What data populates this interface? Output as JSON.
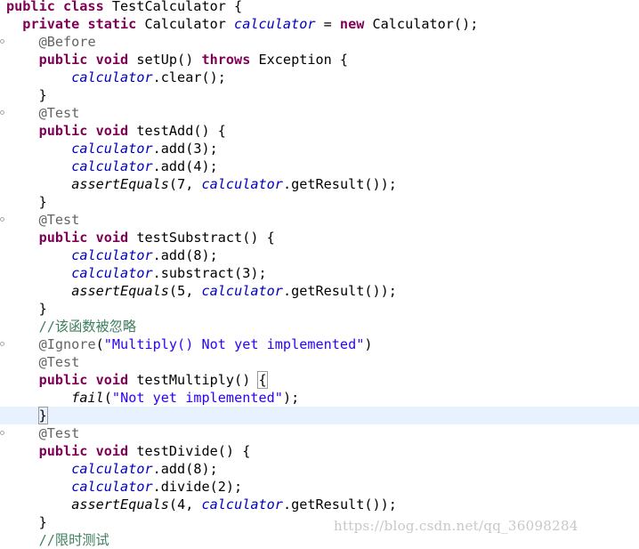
{
  "editor": {
    "lines": [
      {
        "indent": 0,
        "tokens": [
          {
            "t": "kw",
            "v": "public class "
          },
          {
            "t": "plain",
            "v": "TestCalculator {"
          }
        ]
      },
      {
        "indent": 2,
        "tokens": [
          {
            "t": "kw",
            "v": "private static "
          },
          {
            "t": "plain",
            "v": "Calculator "
          },
          {
            "t": "fld",
            "v": "calculator"
          },
          {
            "t": "plain",
            "v": " = "
          },
          {
            "t": "kw",
            "v": "new "
          },
          {
            "t": "plain",
            "v": "Calculator();"
          }
        ]
      },
      {
        "indent": 4,
        "marker": true,
        "tokens": [
          {
            "t": "ann",
            "v": "@Before"
          }
        ]
      },
      {
        "indent": 4,
        "tokens": [
          {
            "t": "kw",
            "v": "public void "
          },
          {
            "t": "plain",
            "v": "setUp() "
          },
          {
            "t": "kw",
            "v": "throws "
          },
          {
            "t": "plain",
            "v": "Exception {"
          }
        ]
      },
      {
        "indent": 8,
        "tokens": [
          {
            "t": "fld",
            "v": "calculator"
          },
          {
            "t": "plain",
            "v": ".clear();"
          }
        ]
      },
      {
        "indent": 4,
        "tokens": [
          {
            "t": "plain",
            "v": "}"
          }
        ]
      },
      {
        "indent": 4,
        "marker": true,
        "tokens": [
          {
            "t": "ann",
            "v": "@Test"
          }
        ]
      },
      {
        "indent": 4,
        "tokens": [
          {
            "t": "kw",
            "v": "public void "
          },
          {
            "t": "plain",
            "v": "testAdd() {"
          }
        ]
      },
      {
        "indent": 8,
        "tokens": [
          {
            "t": "fld",
            "v": "calculator"
          },
          {
            "t": "plain",
            "v": ".add(3);"
          }
        ]
      },
      {
        "indent": 8,
        "tokens": [
          {
            "t": "fld",
            "v": "calculator"
          },
          {
            "t": "plain",
            "v": ".add(4);"
          }
        ]
      },
      {
        "indent": 8,
        "tokens": [
          {
            "t": "stm",
            "v": "assertEquals"
          },
          {
            "t": "plain",
            "v": "(7, "
          },
          {
            "t": "fld",
            "v": "calculator"
          },
          {
            "t": "plain",
            "v": ".getResult());"
          }
        ]
      },
      {
        "indent": 4,
        "tokens": [
          {
            "t": "plain",
            "v": "}"
          }
        ]
      },
      {
        "indent": 4,
        "marker": true,
        "tokens": [
          {
            "t": "ann",
            "v": "@Test"
          }
        ]
      },
      {
        "indent": 4,
        "tokens": [
          {
            "t": "kw",
            "v": "public void "
          },
          {
            "t": "plain",
            "v": "testSubstract() {"
          }
        ]
      },
      {
        "indent": 8,
        "tokens": [
          {
            "t": "fld",
            "v": "calculator"
          },
          {
            "t": "plain",
            "v": ".add(8);"
          }
        ]
      },
      {
        "indent": 8,
        "tokens": [
          {
            "t": "fld",
            "v": "calculator"
          },
          {
            "t": "plain",
            "v": ".substract(3);"
          }
        ]
      },
      {
        "indent": 8,
        "tokens": [
          {
            "t": "stm",
            "v": "assertEquals"
          },
          {
            "t": "plain",
            "v": "(5, "
          },
          {
            "t": "fld",
            "v": "calculator"
          },
          {
            "t": "plain",
            "v": ".getResult());"
          }
        ]
      },
      {
        "indent": 4,
        "tokens": [
          {
            "t": "plain",
            "v": "}"
          }
        ]
      },
      {
        "indent": 4,
        "tokens": [
          {
            "t": "cmt",
            "v": "//该函数被忽略"
          }
        ]
      },
      {
        "indent": 4,
        "marker": true,
        "tokens": [
          {
            "t": "ann",
            "v": "@Ignore"
          },
          {
            "t": "plain",
            "v": "("
          },
          {
            "t": "str",
            "v": "\"Multiply() Not yet implemented\""
          },
          {
            "t": "plain",
            "v": ")"
          }
        ]
      },
      {
        "indent": 4,
        "tokens": [
          {
            "t": "ann",
            "v": "@Test"
          }
        ]
      },
      {
        "indent": 4,
        "tokens": [
          {
            "t": "kw",
            "v": "public void "
          },
          {
            "t": "plain",
            "v": "testMultiply() "
          },
          {
            "t": "box",
            "v": "{"
          }
        ]
      },
      {
        "indent": 8,
        "tokens": [
          {
            "t": "stm",
            "v": "fail"
          },
          {
            "t": "plain",
            "v": "("
          },
          {
            "t": "str",
            "v": "\"Not yet implemented\""
          },
          {
            "t": "plain",
            "v": ");"
          }
        ]
      },
      {
        "indent": 4,
        "current": true,
        "tokens": [
          {
            "t": "box",
            "v": "}"
          }
        ]
      },
      {
        "indent": 4,
        "marker": true,
        "tokens": [
          {
            "t": "ann",
            "v": "@Test"
          }
        ]
      },
      {
        "indent": 4,
        "tokens": [
          {
            "t": "kw",
            "v": "public void "
          },
          {
            "t": "plain",
            "v": "testDivide() {"
          }
        ]
      },
      {
        "indent": 8,
        "tokens": [
          {
            "t": "fld",
            "v": "calculator"
          },
          {
            "t": "plain",
            "v": ".add(8);"
          }
        ]
      },
      {
        "indent": 8,
        "tokens": [
          {
            "t": "fld",
            "v": "calculator"
          },
          {
            "t": "plain",
            "v": ".divide(2);"
          }
        ]
      },
      {
        "indent": 8,
        "tokens": [
          {
            "t": "stm",
            "v": "assertEquals"
          },
          {
            "t": "plain",
            "v": "(4, "
          },
          {
            "t": "fld",
            "v": "calculator"
          },
          {
            "t": "plain",
            "v": ".getResult());"
          }
        ]
      },
      {
        "indent": 4,
        "tokens": [
          {
            "t": "plain",
            "v": "}"
          }
        ]
      },
      {
        "indent": 4,
        "tokens": [
          {
            "t": "cmt",
            "v": "//限时测试"
          }
        ]
      }
    ]
  },
  "watermark": "https://blog.csdn.net/qq_36098284",
  "colors": {
    "keyword": "#7f0055",
    "annotation": "#646464",
    "field": "#0000c0",
    "string": "#2a00ff",
    "comment": "#3f7f5f",
    "current_line": "#e8f2fe"
  }
}
